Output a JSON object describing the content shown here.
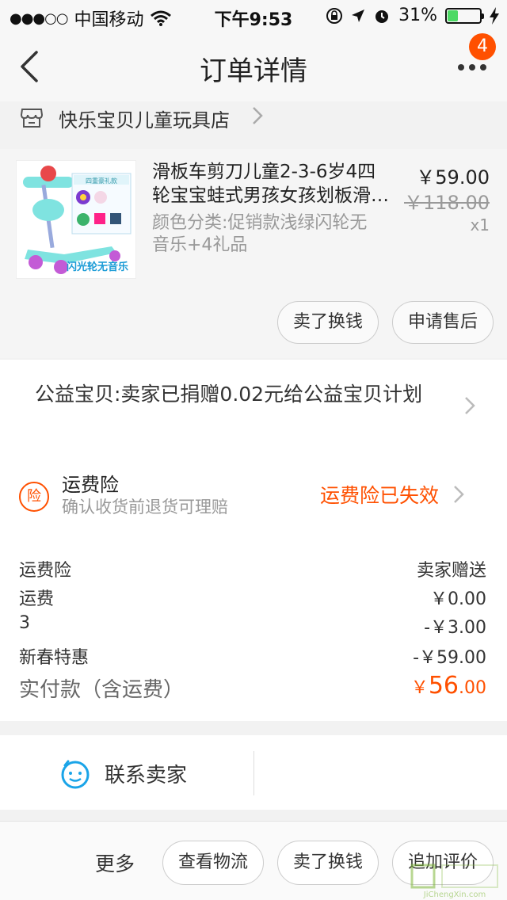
{
  "status_bar": {
    "carrier": "中国移动",
    "time": "下午9:53",
    "battery": "31%"
  },
  "nav": {
    "title": "订单详情",
    "badge": "4"
  },
  "shop": {
    "name": "快乐宝贝儿童玩具店"
  },
  "product": {
    "title_line1": "滑板车剪刀儿童2-3-6岁4四",
    "title_line2": "轮宝宝蛙式男孩女孩划板滑板车",
    "sku_line1": "颜色分类:促销款浅绿闪轮无",
    "sku_line2": "音乐+4礼品",
    "price": "￥59.00",
    "original_price": "￥118.00",
    "quantity": "x1",
    "image_caption": "闪光轮无音乐",
    "image_panel_title": "四重豪礼款"
  },
  "product_actions": {
    "sell_label": "卖了换钱",
    "aftersale_label": "申请售后"
  },
  "charity": {
    "text": "公益宝贝:卖家已捐赠0.02元给公益宝贝计划"
  },
  "insurance": {
    "badge": "险",
    "title": "运费险",
    "subtitle": "确认收货前退货可理赔",
    "status": "运费险已失效"
  },
  "fees": {
    "rows": [
      {
        "label": "运费险",
        "value": "卖家赠送"
      },
      {
        "label": "运费",
        "value": "￥0.00"
      },
      {
        "label": "3",
        "value": "-￥3.00"
      },
      {
        "label": "新春特惠",
        "value": "-￥59.00"
      }
    ],
    "paid_label": "实付款（含运费）",
    "paid_currency": "￥",
    "paid_int": "56",
    "paid_dec": ".00"
  },
  "contact": {
    "label": "联系卖家"
  },
  "bottom_bar": {
    "more_label": "更多",
    "logistics_label": "查看物流",
    "sell_label": "卖了换钱",
    "review_label": "追加评价"
  },
  "watermark": {
    "text": "JiChengXin.com"
  },
  "colors": {
    "accent": "#ff5000",
    "contact_icon": "#1aa4e8",
    "scooter": "#7fe3e0"
  }
}
